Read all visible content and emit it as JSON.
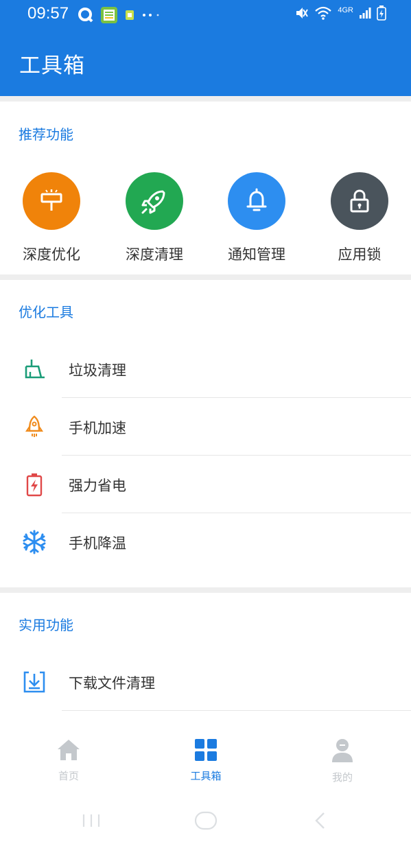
{
  "status": {
    "time": "09:57",
    "network": "4GR"
  },
  "header": {
    "title": "工具箱"
  },
  "recommended": {
    "title": "推荐功能",
    "items": [
      {
        "label": "深度优化",
        "icon": "signpost-icon",
        "color": "#f0830a"
      },
      {
        "label": "深度清理",
        "icon": "rocket-icon",
        "color": "#22a852"
      },
      {
        "label": "通知管理",
        "icon": "bell-icon",
        "color": "#2d8ef0"
      },
      {
        "label": "应用锁",
        "icon": "lock-icon",
        "color": "#4a545c"
      }
    ]
  },
  "optimize": {
    "title": "优化工具",
    "items": [
      {
        "label": "垃圾清理",
        "icon": "broom-icon",
        "color": "#1a9c78"
      },
      {
        "label": "手机加速",
        "icon": "rocket-icon",
        "color": "#f08c1e"
      },
      {
        "label": "强力省电",
        "icon": "battery-icon",
        "color": "#e04848"
      },
      {
        "label": "手机降温",
        "icon": "snowflake-icon",
        "color": "#2d8ef0"
      }
    ]
  },
  "utility": {
    "title": "实用功能",
    "items": [
      {
        "label": "下载文件清理",
        "icon": "download-icon",
        "color": "#2d8ef0"
      }
    ]
  },
  "nav": {
    "items": [
      {
        "label": "首页",
        "icon": "home-icon",
        "active": false
      },
      {
        "label": "工具箱",
        "icon": "grid-icon",
        "active": true
      },
      {
        "label": "我的",
        "icon": "person-icon",
        "active": false
      }
    ],
    "active_color": "#1b7be0",
    "inactive_color": "#c4c8cc"
  }
}
